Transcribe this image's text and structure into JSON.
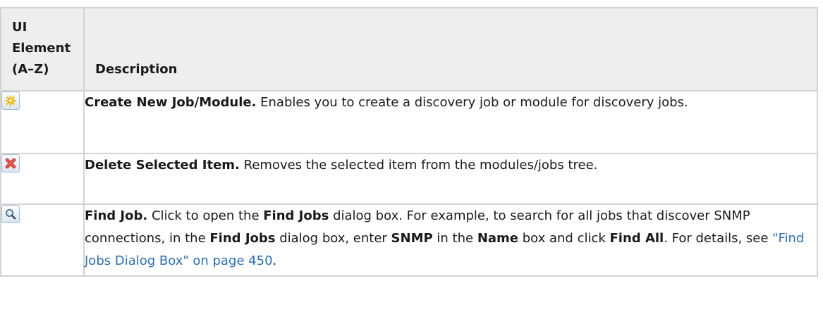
{
  "header": {
    "col1_line1": "UI",
    "col1_line2": "Element",
    "col1_line3": "(A–Z)",
    "col2": "Description"
  },
  "rows": [
    {
      "icon": "create-new-icon",
      "title": "Create New Job/Module.",
      "text": " Enables you to create a discovery job or module for discovery jobs."
    },
    {
      "icon": "delete-icon",
      "title": "Delete Selected Item.",
      "text": " Removes the selected item from the modules/jobs tree."
    },
    {
      "icon": "find-icon",
      "title": "Find Job.",
      "t1": " Click to open the ",
      "b1": "Find Jobs",
      "t2": " dialog box. For example, to search for all jobs that discover SNMP connections, in the ",
      "b2": "Find Jobs",
      "t3": " dialog box, enter ",
      "b3": "SNMP",
      "t4": " in the ",
      "b4": "Name",
      "t5": " box and click ",
      "b5": "Find All",
      "t6": ". For details, see ",
      "link": "\"Find Jobs Dialog Box\" on page 450",
      "t7": "."
    }
  ],
  "colors": {
    "border": "#d3d3d3",
    "header_bg": "#eeeeee",
    "link": "#2f6fb3"
  }
}
